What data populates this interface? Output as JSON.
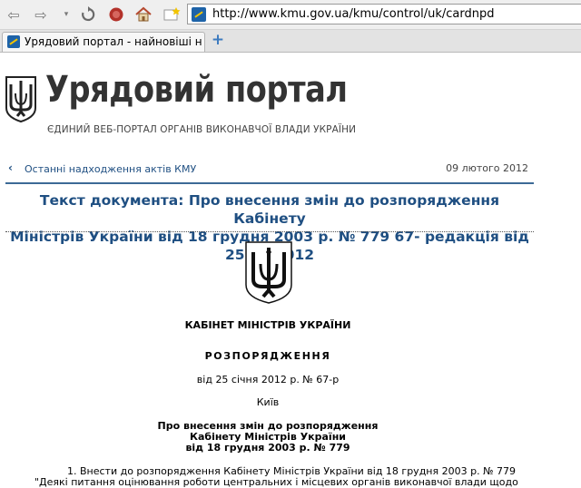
{
  "browser": {
    "url": "http://www.kmu.gov.ua/kmu/control/uk/cardnpd",
    "tab_title": "Урядовий портал - найновіші н...",
    "new_tab": "+"
  },
  "header": {
    "title": "Урядовий портал",
    "subtitle": "ЄДИНИЙ ВЕБ-ПОРТАЛ ОРГАНІВ ВИКОНАВЧОЇ ВЛАДИ УКРАЇНИ"
  },
  "breadcrumb": {
    "back_link": "Останні надходження актів КМУ",
    "date": "09 лютого 2012"
  },
  "document": {
    "title_line1": "Текст документа:  Про внесення змін до розпорядження Кабінету",
    "title_line2": "Міністрів України від 18 грудня 2003 р. № 779 67- редакція від 25.02.2012",
    "issuer": "КАБІНЕТ МІНІСТРІВ УКРАЇНИ",
    "act_type": "РОЗПОРЯДЖЕННЯ",
    "act_date": "від 25 січня 2012 р.  №  67-р",
    "city": "Київ",
    "subject_line1": "Про внесення змін до розпорядження",
    "subject_line2": "Кабінету Міністрів України",
    "subject_line3": "від 18 грудня 2003 р. № 779",
    "para1_line1": "1. Внести до розпорядження Кабінету Міністрів України від 18 грудня 2003 р. № 779",
    "para1_line2": "\"Деякі питання оцінювання роботи центральних і місцевих органів виконавчої влади щодо"
  },
  "colors": {
    "link_blue": "#1f4f82",
    "rule_blue": "#3c6a96",
    "title_gray": "#333333"
  }
}
